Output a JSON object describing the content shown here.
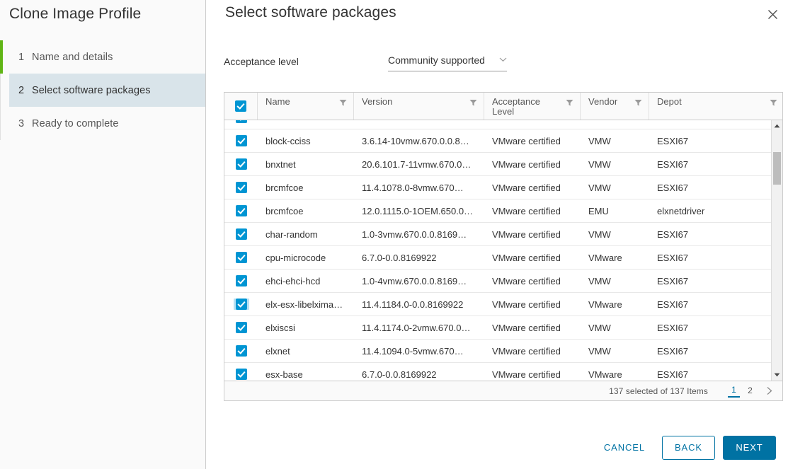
{
  "wizard": {
    "title": "Clone Image Profile",
    "steps": [
      {
        "num": "1",
        "label": "Name and details"
      },
      {
        "num": "2",
        "label": "Select software packages"
      },
      {
        "num": "3",
        "label": "Ready to complete"
      }
    ],
    "active_step_index": 1,
    "accent_color": "#60b515"
  },
  "header": {
    "title": "Select software packages",
    "close_icon": "close-icon"
  },
  "acceptance": {
    "label": "Acceptance level",
    "value": "Community supported",
    "chevron_icon": "chevron-down-icon"
  },
  "table": {
    "select_all_checked": true,
    "columns": [
      {
        "key": "name",
        "label": "Name",
        "filter_icon": "filter-icon"
      },
      {
        "key": "version",
        "label": "Version",
        "filter_icon": "filter-icon"
      },
      {
        "key": "acceptance",
        "label": "Acceptance Level",
        "filter_icon": "filter-icon"
      },
      {
        "key": "vendor",
        "label": "Vendor",
        "filter_icon": "filter-icon"
      },
      {
        "key": "depot",
        "label": "Depot",
        "filter_icon": "filter-icon"
      }
    ],
    "rows": [
      {
        "checked": true,
        "focused": false,
        "name": "",
        "version": "",
        "acceptance": "",
        "vendor": "",
        "depot": ""
      },
      {
        "checked": true,
        "focused": false,
        "name": "block-cciss",
        "version": "3.6.14-10vmw.670.0.0.8…",
        "acceptance": "VMware certified",
        "vendor": "VMW",
        "depot": "ESXI67"
      },
      {
        "checked": true,
        "focused": false,
        "name": "bnxtnet",
        "version": "20.6.101.7-11vmw.670.0…",
        "acceptance": "VMware certified",
        "vendor": "VMW",
        "depot": "ESXI67"
      },
      {
        "checked": true,
        "focused": false,
        "name": "brcmfcoe",
        "version": "11.4.1078.0-8vmw.670…",
        "acceptance": "VMware certified",
        "vendor": "VMW",
        "depot": "ESXI67"
      },
      {
        "checked": true,
        "focused": false,
        "name": "brcmfcoe",
        "version": "12.0.1115.0-1OEM.650.0…",
        "acceptance": "VMware certified",
        "vendor": "EMU",
        "depot": "elxnetdriver"
      },
      {
        "checked": true,
        "focused": false,
        "name": "char-random",
        "version": "1.0-3vmw.670.0.0.8169…",
        "acceptance": "VMware certified",
        "vendor": "VMW",
        "depot": "ESXI67"
      },
      {
        "checked": true,
        "focused": false,
        "name": "cpu-microcode",
        "version": "6.7.0-0.0.8169922",
        "acceptance": "VMware certified",
        "vendor": "VMware",
        "depot": "ESXI67"
      },
      {
        "checked": true,
        "focused": false,
        "name": "ehci-ehci-hcd",
        "version": "1.0-4vmw.670.0.0.8169…",
        "acceptance": "VMware certified",
        "vendor": "VMW",
        "depot": "ESXI67"
      },
      {
        "checked": true,
        "focused": true,
        "name": "elx-esx-libelxima…",
        "version": "11.4.1184.0-0.0.8169922",
        "acceptance": "VMware certified",
        "vendor": "VMware",
        "depot": "ESXI67"
      },
      {
        "checked": true,
        "focused": false,
        "name": "elxiscsi",
        "version": "11.4.1174.0-2vmw.670.0…",
        "acceptance": "VMware certified",
        "vendor": "VMW",
        "depot": "ESXI67"
      },
      {
        "checked": true,
        "focused": false,
        "name": "elxnet",
        "version": "11.4.1094.0-5vmw.670…",
        "acceptance": "VMware certified",
        "vendor": "VMW",
        "depot": "ESXI67"
      },
      {
        "checked": true,
        "focused": false,
        "name": "esx-base",
        "version": "6.7.0-0.0.8169922",
        "acceptance": "VMware certified",
        "vendor": "VMware",
        "depot": "ESXI67"
      }
    ],
    "footer": {
      "count_text": "137 selected of 137 Items",
      "pages": [
        "1",
        "2"
      ],
      "active_page": "1",
      "next_icon": "chevron-right-icon"
    },
    "scrollbar": {
      "up_icon": "caret-up-icon",
      "down_icon": "caret-down-icon"
    }
  },
  "footer": {
    "cancel_label": "CANCEL",
    "back_label": "BACK",
    "next_label": "NEXT",
    "primary_color": "#0072a3"
  }
}
